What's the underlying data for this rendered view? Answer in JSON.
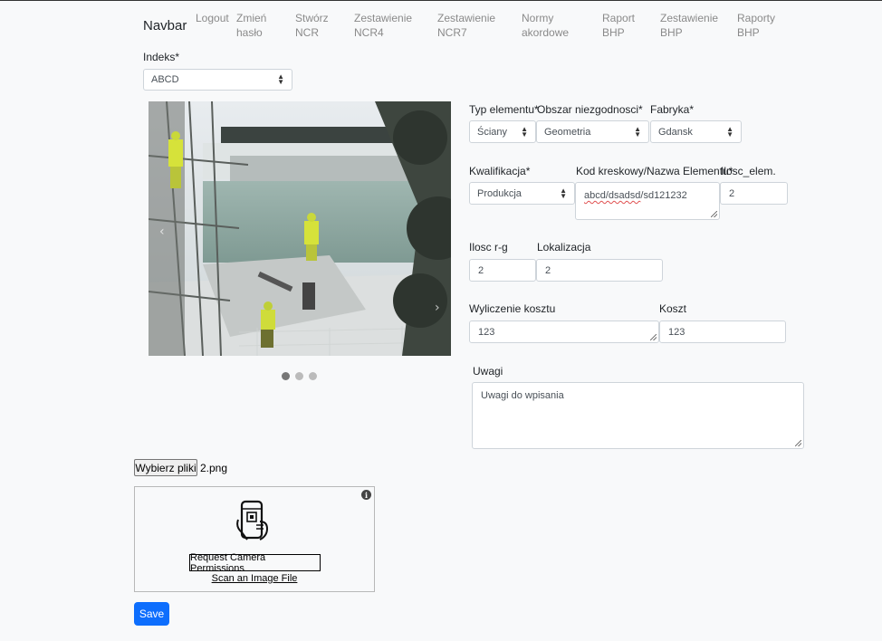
{
  "navbar": {
    "brand": "Navbar",
    "links": [
      {
        "line1": "Logout",
        "line2": ""
      },
      {
        "line1": "Zmień",
        "line2": "hasło"
      },
      {
        "line1": "Stwórz",
        "line2": "NCR"
      },
      {
        "line1": "Zestawienie",
        "line2": "NCR4"
      },
      {
        "line1": "Zestawienie",
        "line2": "NCR7"
      },
      {
        "line1": "Normy",
        "line2": "akordowe"
      },
      {
        "line1": "Raport",
        "line2": "BHP"
      },
      {
        "line1": "Zestawienie",
        "line2": "BHP"
      },
      {
        "line1": "Raporty",
        "line2": "BHP"
      }
    ]
  },
  "form": {
    "indeks": {
      "label": "Indeks*",
      "value": "ABCD"
    },
    "typ_elementu": {
      "label": "Typ elementu*",
      "value": "Ściany"
    },
    "obszar": {
      "label": "Obszar niezgodnosci*",
      "value": "Geometria"
    },
    "fabryka": {
      "label": "Fabryka*",
      "value": "Gdansk"
    },
    "kwalifikacja": {
      "label": "Kwalifikacja*",
      "value": "Produkcja"
    },
    "kod": {
      "label": "Kod kreskowy/Nazwa Elementu*",
      "value_part1": "abcd/dsadsd",
      "value_part2": "/sd121232"
    },
    "ilosc_elem": {
      "label": "Ilosc_elem.",
      "value": "2"
    },
    "ilosc_rg": {
      "label": "Ilosc r-g",
      "value": "2"
    },
    "lokalizacja": {
      "label": "Lokalizacja",
      "value": "2"
    },
    "wyliczenie": {
      "label": "Wyliczenie kosztu",
      "value": "123"
    },
    "koszt": {
      "label": "Koszt",
      "value": "123"
    },
    "uwagi": {
      "label": "Uwagi",
      "value": "Uwagi do wpisania"
    },
    "file": {
      "button_label": "Wybierz pliki",
      "filename": "2.png"
    },
    "save_label": "Save"
  },
  "carousel": {
    "slides": 3,
    "active": 0
  },
  "scanner": {
    "permission_button": "Request Camera Permissions",
    "scan_file_link": "Scan an Image File",
    "info_symbol": "i"
  },
  "icons": {
    "scanner": "phone-qr-scan-icon",
    "info": "info-icon",
    "select_arrows": "select-arrows-icon"
  }
}
